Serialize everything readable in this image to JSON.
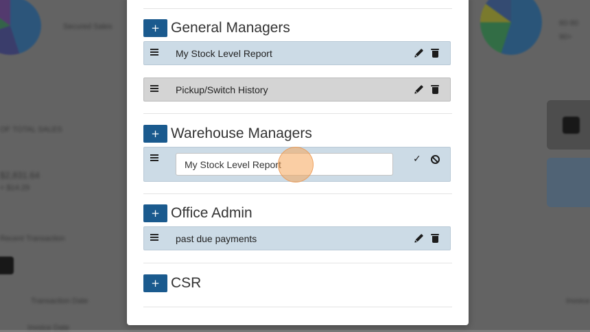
{
  "background": {
    "left_caption": "Secured Sales",
    "left_line1": "OF TOTAL SALES",
    "left_value": "$2,831.64",
    "left_sub": "+ $14.29",
    "left_section": "Recent Transaction",
    "right_caption1": "60-90",
    "right_caption2": "90+",
    "bottom_col1": "Transaction Date",
    "bottom_col2": "Invoice",
    "bottom_row": "Invoice Date"
  },
  "groups": [
    {
      "title": "General Managers",
      "add_label": "+",
      "rows": [
        {
          "label": "My Stock Level Report"
        },
        {
          "label": "Pickup/Switch History"
        }
      ]
    },
    {
      "title": "Warehouse Managers",
      "add_label": "+",
      "editing": {
        "input_value": "My Stock Level Report"
      }
    },
    {
      "title": "Office Admin",
      "add_label": "+",
      "rows": [
        {
          "label": "past due payments"
        }
      ]
    },
    {
      "title": "CSR",
      "add_label": "+"
    }
  ],
  "icons": {
    "drag": "drag-handle-icon",
    "edit": "pencil-icon",
    "delete": "trash-icon",
    "save": "check-icon",
    "cancel": "ban-icon"
  },
  "colors": {
    "add_button": "#1a5a8e",
    "row_blue": "#ccdbe6",
    "row_gray": "#d4d4d4",
    "cursor_highlight": "#f5a65a"
  }
}
